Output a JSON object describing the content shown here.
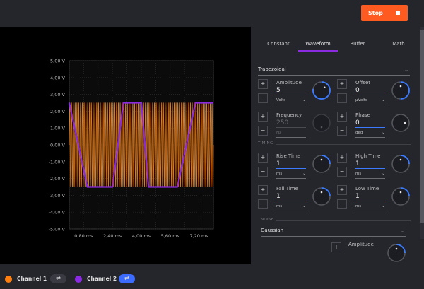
{
  "topbar": {
    "stop_label": "Stop",
    "stop_color": "#ff5a1f"
  },
  "chart_data": {
    "type": "line",
    "x_ticks": [
      "0,80 ms",
      "2,40 ms",
      "4,00 ms",
      "5,60 ms",
      "7,20 ms"
    ],
    "y_ticks": [
      "5,00 V",
      "4,00 V",
      "3,00 V",
      "2,00 V",
      "1,00 V",
      "0,00 V",
      "-1,00 V",
      "-2,00 V",
      "-3,00 V",
      "-4,00 V",
      "-5,00 V"
    ],
    "xlim": [
      0,
      8
    ],
    "ylim": [
      -5,
      5
    ],
    "grid": true,
    "series": [
      {
        "color": "#e37a1a",
        "shape": "sine",
        "amplitude": 2.5,
        "offset": 0,
        "cycles": 80
      },
      {
        "color": "#8a2be2",
        "shape": "trapezoidal",
        "x": [
          0,
          1.0,
          1.4,
          2.4,
          3.0,
          4.0,
          4.4,
          5.4,
          6.0,
          7.0,
          7.4,
          8.0
        ],
        "y": [
          2.5,
          -2.5,
          -2.5,
          -2.5,
          2.5,
          2.5,
          -2.5,
          -2.5,
          -2.5,
          2.5,
          2.5,
          2.5
        ]
      }
    ]
  },
  "panel": {
    "tabs": [
      "Constant",
      "Waveform",
      "Buffer",
      "Math"
    ],
    "active_tab": "Waveform",
    "waveform_type": "Trapezoidal",
    "params": {
      "amplitude": {
        "label": "Amplitude",
        "value": "5",
        "unit": "Volts"
      },
      "offset": {
        "label": "Offset",
        "value": "0",
        "unit": "µVolts"
      },
      "frequency": {
        "label": "Frequency",
        "value": "250",
        "unit": "Hz"
      },
      "phase": {
        "label": "Phase",
        "value": "0",
        "unit": "deg"
      },
      "rise_time": {
        "label": "Rise Time",
        "value": "1",
        "unit": "ms"
      },
      "high_time": {
        "label": "High Time",
        "value": "1",
        "unit": "ms"
      },
      "fall_time": {
        "label": "Fall Time",
        "value": "1",
        "unit": "ms"
      },
      "low_time": {
        "label": "Low Time",
        "value": "1",
        "unit": "ms"
      },
      "noise_amplitude": {
        "label": "Amplitude"
      }
    },
    "sections": {
      "timing": "TIMING",
      "noise": "NOISE"
    },
    "noise_type": "Gaussian",
    "plus": "+",
    "minus": "−"
  },
  "bottombar": {
    "channels": [
      {
        "label": "Channel 1",
        "color": "#ff7f0e",
        "btn_icon": "⇌",
        "btn_bg": "#3a3b42"
      },
      {
        "label": "Channel 2",
        "color": "#8a2be2",
        "btn_icon": "⇄",
        "btn_bg": "#3b6cff"
      }
    ]
  },
  "icons": {
    "chevron": "⌄"
  }
}
